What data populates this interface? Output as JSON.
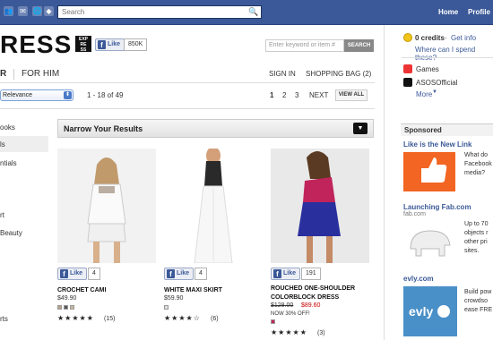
{
  "facebook_bar": {
    "search_placeholder": "Search",
    "home": "Home",
    "profile": "Profile"
  },
  "store": {
    "logo_text": "RESS",
    "badge_text": "EXP RESS",
    "like_label": "Like",
    "like_count": "850K",
    "keyword_placeholder": "Enter keyword or item #",
    "search_button": "SEARCH",
    "nav": {
      "her": "R",
      "him": "FOR HIM"
    },
    "sign_in": "SIGN IN",
    "shopping_bag": "SHOPPING BAG (2)",
    "sort_value": "Relevance",
    "range": "1 - 18 of 49",
    "pages": [
      "1",
      "2",
      "3"
    ],
    "next": "NEXT",
    "view_all": "VIEW ALL",
    "sidebar": [
      "ooks",
      "ls",
      "ntials",
      "rt",
      "Beauty",
      "rts"
    ],
    "narrow_title": "Narrow Your Results"
  },
  "products": [
    {
      "like": "Like",
      "count": "4",
      "name": "CROCHET CAMI",
      "price": "$49.90",
      "stars": "★★★★★",
      "reviews": "(15)",
      "swatches": [
        "#b8a48a",
        "#555555",
        "#c8b89a"
      ]
    },
    {
      "like": "Like",
      "count": "4",
      "name": "WHITE MAXI SKIRT",
      "price": "$59.90",
      "stars": "★★★★☆",
      "reviews": "(6)",
      "swatches": [
        "#dddddd"
      ]
    },
    {
      "like": "Like",
      "count": "191",
      "name": "ROUCHED ONE-SHOULDER COLORBLOCK DRESS",
      "old_price": "$128.00",
      "sale_price": "$89.60",
      "promo": "NOW 30% OFF!",
      "stars": "★★★★★",
      "reviews": "(3)",
      "swatches": [
        "#c0245a"
      ]
    }
  ],
  "right_col": {
    "credits": "0 credits",
    "get_info": "Get info",
    "spend": "Where can I spend these?",
    "apps": [
      "Games",
      "ASOSOfficial"
    ],
    "more": "More",
    "sponsored": "Sponsored",
    "ads": [
      {
        "title": "Like is the New Link",
        "sub": "",
        "body": [
          "What do",
          "Facebook",
          "media?"
        ]
      },
      {
        "title": "Launching Fab.com",
        "sub": "fab.com",
        "body": [
          "Up to 70",
          "objects r",
          "other pri",
          "sites."
        ]
      },
      {
        "title": "evly.com",
        "sub": "",
        "body": [
          "Build pow",
          "crowdso",
          "ease FRE"
        ]
      }
    ]
  },
  "colors": {
    "facebook_blue": "#3b5998",
    "sale_red": "#cc0000"
  }
}
